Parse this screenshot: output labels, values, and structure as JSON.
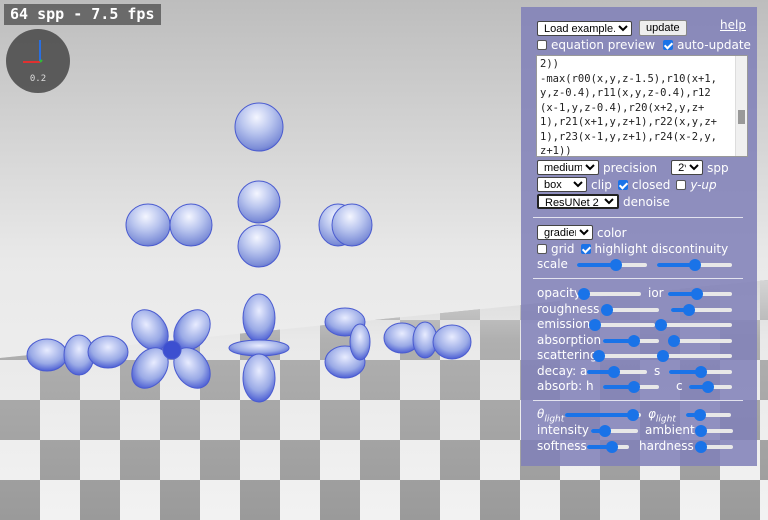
{
  "viewport": {
    "fps_text": "64 spp - 7.5 fps",
    "axes_scale": "0.2"
  },
  "panel": {
    "example_select": "Load example...",
    "update_button": "update",
    "help_link": "help",
    "equation_preview": {
      "label": "equation preview",
      "checked": false
    },
    "auto_update": {
      "label": "auto-update",
      "checked": true
    },
    "equation_lines": [
      "2))",
      "-max(r00(x,y,z-1.5),r10(x+1,",
      "y,z-0.4),r11(x,y,z-0.4),r12",
      "(x-1,y,z-0.4),r20(x+2,y,z+",
      "1),r21(x+1,y,z+1),r22(x,y,z+",
      "1),r23(x-1,y,z+1),r24(x-2,y,",
      "z+1))"
    ],
    "precision_select": "medium",
    "precision_label": "precision",
    "spp_select": "2*",
    "spp_label": "spp",
    "clip_select": "box",
    "clip_label": "clip",
    "closed": {
      "label": "closed",
      "checked": true
    },
    "y_up": {
      "label": "y-up",
      "checked": false
    },
    "denoise_select": "ResUNet 2",
    "denoise_label": "denoise",
    "color_select": "gradient",
    "color_label": "color",
    "grid": {
      "label": "grid",
      "checked": false
    },
    "highlight": {
      "label": "highlight discontinuity",
      "checked": true
    },
    "scale_label": "scale",
    "scale_sliders": [
      0.55,
      0.5
    ],
    "material_sliders": [
      {
        "label": "opacity",
        "value": 0.05,
        "label2": "ior",
        "value2": 0.45
      },
      {
        "label": "roughness",
        "value": 0.1,
        "value2": 0.3
      },
      {
        "label": "emission",
        "value": 0.0,
        "value2": 0.0
      },
      {
        "label": "absorption",
        "value": 0.55,
        "value2": 0.05
      },
      {
        "label": "scattering",
        "value": 0.0,
        "value2": 0.0
      },
      {
        "label": "decay: a",
        "value": 0.45,
        "label2": "s",
        "value2": 0.5
      },
      {
        "label": "absorb: h",
        "value": 0.55,
        "label2": "c",
        "value2": 0.45
      }
    ],
    "light_sliders": [
      {
        "label": "θ",
        "sub": "light",
        "value": 0.9,
        "label2": "φ",
        "sub2": "light",
        "value2": 0.3
      },
      {
        "label": "intensity",
        "value": 0.3,
        "label2": "ambient",
        "value2": 0.1
      },
      {
        "label": "softness",
        "value": 0.6,
        "label2": "hardness",
        "value2": 0.1
      }
    ]
  }
}
